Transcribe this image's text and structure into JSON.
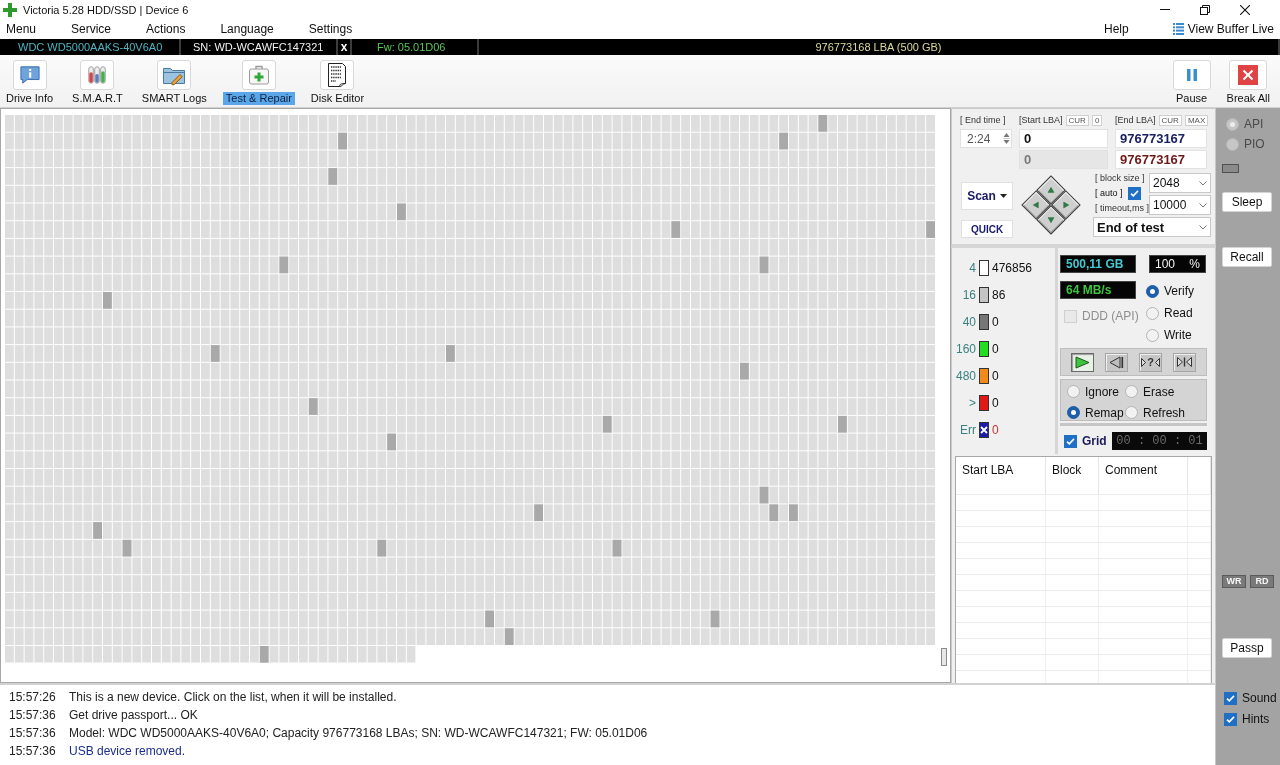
{
  "window": {
    "title": "Victoria 5.28 HDD/SSD | Device 6"
  },
  "menu": {
    "items": [
      "Menu",
      "Service",
      "Actions",
      "Language",
      "Settings"
    ],
    "help": "Help",
    "buffer_view": "View Buffer Live"
  },
  "device_bar": {
    "model": "WDC WD5000AAKS-40V6A0",
    "serial": "SN: WD-WCAWFC147321",
    "close": "x",
    "firmware": "Fw: 05.01D06",
    "capacity": "976773168 LBA (500 GB)"
  },
  "toolbar": {
    "tools": [
      {
        "kind": "info",
        "label": "Drive Info",
        "selected": false
      },
      {
        "kind": "smart",
        "label": "S.M.A.R.T",
        "selected": false
      },
      {
        "kind": "logs",
        "label": "SMART Logs",
        "selected": false
      },
      {
        "kind": "repair",
        "label": "Test & Repair",
        "selected": true
      },
      {
        "kind": "editor",
        "label": "Disk Editor",
        "selected": false
      }
    ],
    "actions": [
      {
        "kind": "pause",
        "label": "Pause"
      },
      {
        "kind": "break",
        "label": "Break All"
      }
    ]
  },
  "range": {
    "end_time_label": "[ End time ]",
    "end_time": "2:24",
    "start_label": "[Start LBA]",
    "start_tags": [
      "CUR",
      "0"
    ],
    "end_label": "[End LBA]",
    "end_tags": [
      "CUR",
      "MAX"
    ],
    "fields": [
      {
        "kind": "start",
        "value": "0",
        "disabled": false
      },
      {
        "kind": "end",
        "value": "976773167",
        "disabled": false
      },
      {
        "kind": "current_start",
        "value": "0",
        "disabled": true
      },
      {
        "kind": "current_end",
        "value": "976773167",
        "disabled": false
      }
    ]
  },
  "scan": {
    "button": "Scan",
    "quick": "QUICK",
    "block_size_label": "[ block size ]",
    "auto_label": "[ auto ]",
    "auto": true,
    "block_size": "2048",
    "timeout_label": "[ timeout,ms ]",
    "timeout": "10000",
    "on_finish": "End of test"
  },
  "legend": [
    {
      "kind": "block",
      "label": "4",
      "count": "476856",
      "color": "#ffffff"
    },
    {
      "kind": "block",
      "label": "16",
      "count": "86",
      "color": "#c4c4c4"
    },
    {
      "kind": "block",
      "label": "40",
      "count": "0",
      "color": "#767676"
    },
    {
      "kind": "block",
      "label": "160",
      "count": "0",
      "color": "#22dd22"
    },
    {
      "kind": "block",
      "label": "480",
      "count": "0",
      "color": "#f08a1c"
    },
    {
      "kind": "block",
      "label": ">",
      "count": "0",
      "color": "#e01818"
    },
    {
      "kind": "error",
      "label": "Err",
      "count": "0",
      "color": "#1c1ca8"
    }
  ],
  "stats": {
    "size": "500,11 GB",
    "percent": "100",
    "percent_sign": "%",
    "speed": "64 MB/s"
  },
  "modes": [
    {
      "label": "Verify",
      "selected": true
    },
    {
      "label": "Read",
      "selected": false
    },
    {
      "label": "Write",
      "selected": false
    }
  ],
  "ddd": {
    "label": "DDD (API)",
    "checked": false,
    "disabled": true
  },
  "player": [
    {
      "kind": "play",
      "selected": true
    },
    {
      "kind": "reverse",
      "selected": false
    },
    {
      "kind": "random",
      "label": "?",
      "selected": false
    },
    {
      "kind": "butterfly",
      "selected": false
    }
  ],
  "on_error": [
    {
      "label": "Ignore",
      "selected": false
    },
    {
      "label": "Erase",
      "selected": false
    },
    {
      "label": "Remap",
      "selected": true
    },
    {
      "label": "Refresh",
      "selected": false
    }
  ],
  "grid": {
    "label": "Grid",
    "checked": true,
    "timer": "00 : 00 : 01"
  },
  "defects": {
    "columns": [
      "Start LBA",
      "Block",
      "Comment"
    ]
  },
  "side": {
    "interfaces": [
      {
        "label": "API",
        "selected": true,
        "disabled": true
      },
      {
        "label": "PIO",
        "selected": false,
        "disabled": true
      }
    ],
    "sleep": "Sleep",
    "recall": "Recall",
    "indicators": [
      {
        "label": "WR"
      },
      {
        "label": "RD"
      }
    ],
    "passport": "Passp",
    "options": [
      {
        "label": "Sound",
        "checked": true
      },
      {
        "label": "Hints",
        "checked": true
      }
    ]
  },
  "log": [
    {
      "time": "15:57:26",
      "message": "This is a new device. Click on the list, when it will be installed.",
      "kind": "info"
    },
    {
      "time": "15:57:36",
      "message": "Get drive passport... OK",
      "kind": "info"
    },
    {
      "time": "15:57:36",
      "message": "Model: WDC WD5000AAKS-40V6A0; Capacity 976773168 LBAs; SN: WD-WCAWFC147321; FW: 05.01D06",
      "kind": "info"
    },
    {
      "time": "15:57:36",
      "message": "USB device removed.",
      "kind": "notice"
    }
  ]
}
